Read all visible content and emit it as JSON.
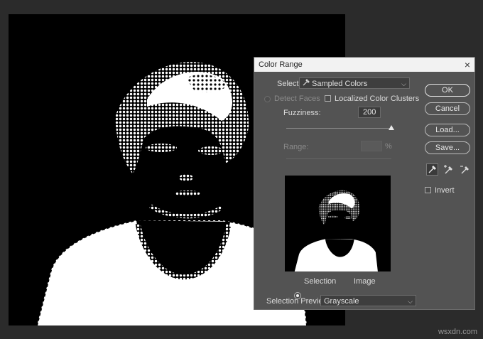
{
  "watermark": "wsxdn.com",
  "dialog": {
    "title": "Color Range",
    "close_glyph": "×",
    "select_label": "Select:",
    "select_value": "Sampled Colors",
    "detect_faces_label": "Detect Faces",
    "localized_label": "Localized Color Clusters",
    "fuzziness_label": "Fuzziness:",
    "fuzziness_value": "200",
    "range_label": "Range:",
    "range_unit": "%",
    "selection_label": "Selection",
    "image_label": "Image",
    "sel_preview_label": "Selection Preview:",
    "sel_preview_value": "Grayscale",
    "ok_label": "OK",
    "cancel_label": "Cancel",
    "load_label": "Load...",
    "save_label": "Save...",
    "invert_label": "Invert",
    "fuzziness_level": 1.0
  },
  "icons": {
    "eyedropper": "eyedropper-icon",
    "eyedropper_plus": "eyedropper-plus-icon",
    "eyedropper_minus": "eyedropper-minus-icon"
  }
}
